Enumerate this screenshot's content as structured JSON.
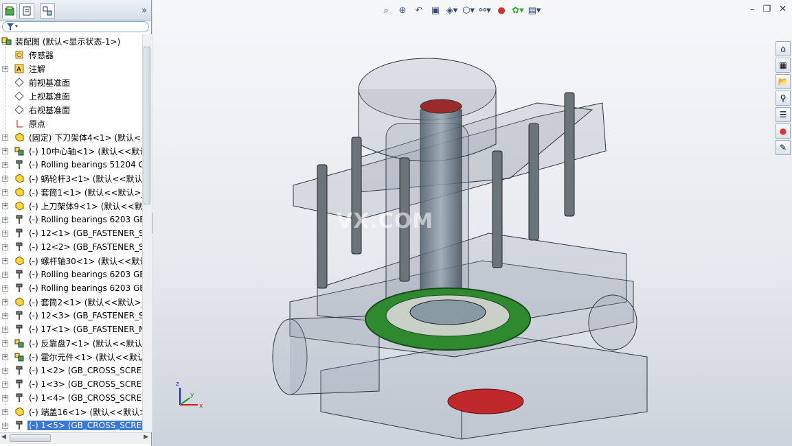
{
  "feature_tree": {
    "root_label": "装配图 (默认<显示状态-1>)",
    "items": [
      {
        "label": "传感器",
        "icon": "sensor-icon",
        "expand": false
      },
      {
        "label": "注解",
        "icon": "annotation-icon",
        "expand": true
      },
      {
        "label": "前视基准面",
        "icon": "plane-icon",
        "expand": false
      },
      {
        "label": "上视基准面",
        "icon": "plane-icon",
        "expand": false
      },
      {
        "label": "右视基准面",
        "icon": "plane-icon",
        "expand": false
      },
      {
        "label": "原点",
        "icon": "origin-icon",
        "expand": false
      },
      {
        "label": "(固定) 下刀架体4<1> (默认<<",
        "icon": "part-icon",
        "expand": true
      },
      {
        "label": "(-) 10中心轴<1> (默认<<默认",
        "icon": "subassembly-icon",
        "expand": true
      },
      {
        "label": "(-) Rolling bearings 51204 G",
        "icon": "fastener-icon",
        "expand": true
      },
      {
        "label": "(-) 蜗轮杆3<1> (默认<<默认>",
        "icon": "part-icon",
        "expand": true
      },
      {
        "label": "(-) 套筒1<1> (默认<<默认>_",
        "icon": "part-icon",
        "expand": true
      },
      {
        "label": "(-) 上刀架体9<1> (默认<<默认",
        "icon": "part-icon",
        "expand": true
      },
      {
        "label": "(-) Rolling bearings 6203 GB",
        "icon": "fastener-icon",
        "expand": true
      },
      {
        "label": "(-) 12<1> (GB_FASTENER_SC",
        "icon": "fastener-icon",
        "expand": true
      },
      {
        "label": "(-) 12<2> (GB_FASTENER_SC",
        "icon": "fastener-icon",
        "expand": true
      },
      {
        "label": "(-) 螺杆轴30<1> (默认<<默认",
        "icon": "part-icon",
        "expand": true
      },
      {
        "label": "(-) Rolling bearings 6203 GB",
        "icon": "fastener-icon",
        "expand": true
      },
      {
        "label": "(-) Rolling bearings 6203 GB",
        "icon": "fastener-icon",
        "expand": true
      },
      {
        "label": "(-) 套筒2<1> (默认<<默认>_",
        "icon": "part-icon",
        "expand": true
      },
      {
        "label": "(-) 12<3> (GB_FASTENER_SC",
        "icon": "fastener-icon",
        "expand": true
      },
      {
        "label": "(-) 17<1> (GB_FASTENER_NI",
        "icon": "fastener-icon",
        "expand": true
      },
      {
        "label": "(-) 反靠盘7<1> (默认<<默认>",
        "icon": "subassembly-icon",
        "expand": true
      },
      {
        "label": "(-) 霍尔元件<1> (默认<<默认",
        "icon": "subassembly-icon",
        "expand": true
      },
      {
        "label": "(-) 1<2> (GB_CROSS_SCREW",
        "icon": "fastener-icon",
        "expand": true
      },
      {
        "label": "(-) 1<3> (GB_CROSS_SCREW",
        "icon": "fastener-icon",
        "expand": true
      },
      {
        "label": "(-) 1<4> (GB_CROSS_SCREW",
        "icon": "fastener-icon",
        "expand": true
      },
      {
        "label": "(-) 端盖16<1> (默认<<默认>",
        "icon": "part-icon",
        "expand": true
      },
      {
        "label": "(-) 1<5> (GB_CROSS_SCREW",
        "icon": "fastener-icon",
        "expand": true,
        "selected": true
      }
    ]
  },
  "watermark": "VX.COM",
  "triad": {
    "x": "x",
    "y": "y",
    "z": "z"
  },
  "colors": {
    "selection": "#3a78d8",
    "gear": "#2f8a2f",
    "part_red": "#c0292b"
  }
}
